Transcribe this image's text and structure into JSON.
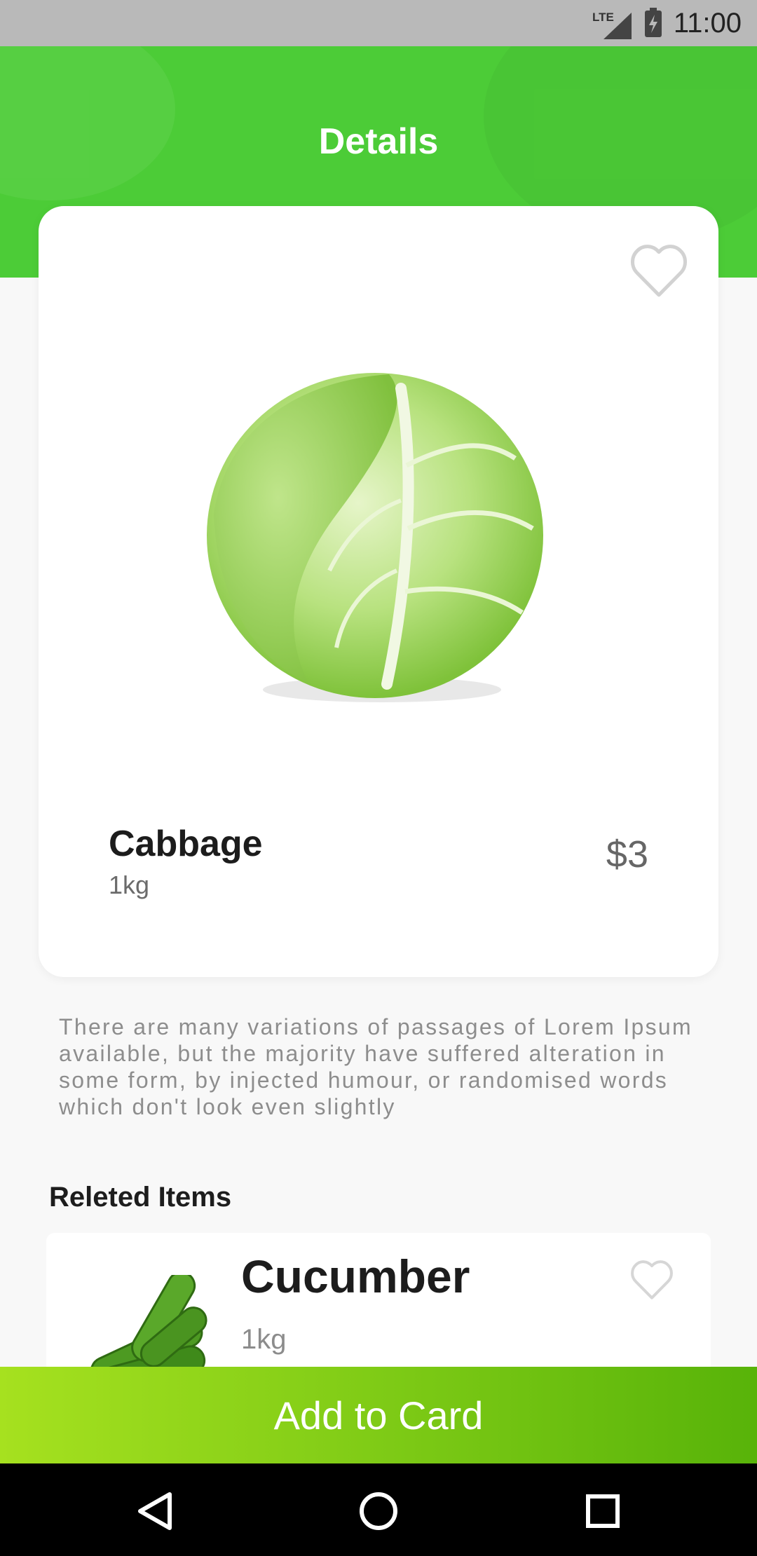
{
  "status_bar": {
    "network": "LTE",
    "time": "11:00"
  },
  "header": {
    "title": "Details"
  },
  "product": {
    "name": "Cabbage",
    "unit": "1kg",
    "price": "$3",
    "favorite_icon": "heart-outline-icon",
    "image": "cabbage-image"
  },
  "description": "There are many variations of passages of Lorem Ipsum available, but the majority have suffered alteration in some form, by injected humour, or randomised words which don't look even slightly",
  "related": {
    "title": "Releted Items",
    "items": [
      {
        "name": "Cucumber",
        "unit": "1kg",
        "image": "cucumber-image",
        "favorite_icon": "heart-outline-icon"
      }
    ]
  },
  "actions": {
    "add_to_cart_label": "Add to Card"
  },
  "nav_bar": {
    "back_icon": "back-triangle-icon",
    "home_icon": "home-circle-icon",
    "recents_icon": "recents-square-icon"
  },
  "colors": {
    "header_green": "#4ccc37",
    "button_gradient_start": "#a6e11f",
    "button_gradient_end": "#58b309",
    "page_background": "#f8f8f8"
  }
}
